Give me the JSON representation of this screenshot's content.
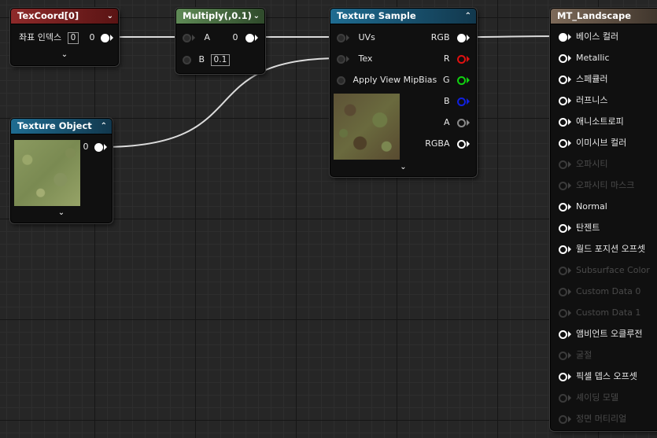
{
  "colors": {
    "wire": "#dcdcdc",
    "pin_r": "#e01010",
    "pin_g": "#10d010",
    "pin_b": "#1020e0",
    "pin_a": "#8a8a8a"
  },
  "texcoord": {
    "title": "TexCoord[0]",
    "index_label": "좌표 인덱스",
    "index_value": "0",
    "out_label": "0"
  },
  "multiply": {
    "title": "Multiply(,0.1)",
    "in_a": "A",
    "in_b": "B",
    "b_value": "0.1",
    "out_label": "0"
  },
  "texture_object": {
    "title": "Texture Object",
    "out_label": "0"
  },
  "texture_sample": {
    "title": "Texture Sample",
    "inputs": [
      "UVs",
      "Tex",
      "Apply View MipBias"
    ],
    "outputs": [
      "RGB",
      "R",
      "G",
      "B",
      "A",
      "RGBA"
    ]
  },
  "material": {
    "title": "MT_Landscape",
    "pins": [
      {
        "label": "베이스 컬러",
        "enabled": true
      },
      {
        "label": "Metallic",
        "enabled": true
      },
      {
        "label": "스페큘러",
        "enabled": true
      },
      {
        "label": "러프니스",
        "enabled": true
      },
      {
        "label": "애니소트로피",
        "enabled": true
      },
      {
        "label": "이미시브 컬러",
        "enabled": true
      },
      {
        "label": "오파시티",
        "enabled": false
      },
      {
        "label": "오파시티 마스크",
        "enabled": false
      },
      {
        "label": "Normal",
        "enabled": true
      },
      {
        "label": "탄젠트",
        "enabled": true
      },
      {
        "label": "월드 포지션 오프셋",
        "enabled": true
      },
      {
        "label": "Subsurface Color",
        "enabled": false
      },
      {
        "label": "Custom Data 0",
        "enabled": false
      },
      {
        "label": "Custom Data 1",
        "enabled": false
      },
      {
        "label": "앰비언트 오클루전",
        "enabled": true
      },
      {
        "label": "굴절",
        "enabled": false
      },
      {
        "label": "픽셀 뎁스 오프셋",
        "enabled": true
      },
      {
        "label": "셰이딩 모델",
        "enabled": false
      },
      {
        "label": "정면 머티리얼",
        "enabled": false
      }
    ]
  },
  "icons": {
    "collapse": "chevron-down-icon",
    "expand": "chevron-down-icon"
  }
}
